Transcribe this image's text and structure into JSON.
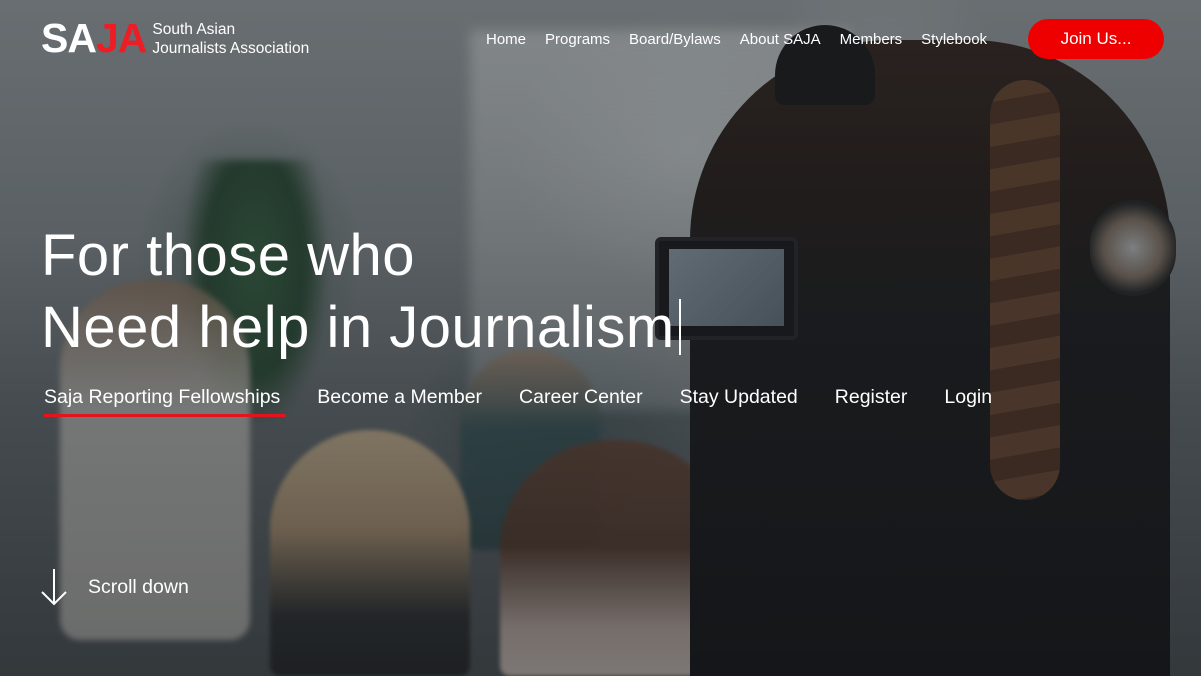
{
  "brand": {
    "logo_sa": "SA",
    "logo_ja": "JA",
    "name_line1": "South Asian",
    "name_line2": "Journalists Association",
    "accent_color": "#ee1c25"
  },
  "nav": {
    "items": [
      {
        "label": "Home"
      },
      {
        "label": "Programs"
      },
      {
        "label": "Board/Bylaws"
      },
      {
        "label": "About SAJA"
      },
      {
        "label": "Members"
      },
      {
        "label": "Stylebook"
      }
    ],
    "cta_label": "Join Us..."
  },
  "hero": {
    "headline_line1": "For those who",
    "headline_line2": "Need help in Journalism",
    "links": [
      {
        "label": "Saja Reporting Fellowships",
        "active": true
      },
      {
        "label": "Become a Member"
      },
      {
        "label": "Career Center"
      },
      {
        "label": "Stay Updated"
      },
      {
        "label": "Register"
      },
      {
        "label": "Login"
      }
    ],
    "scroll_label": "Scroll down",
    "scroll_icon": "arrow-down-icon"
  }
}
